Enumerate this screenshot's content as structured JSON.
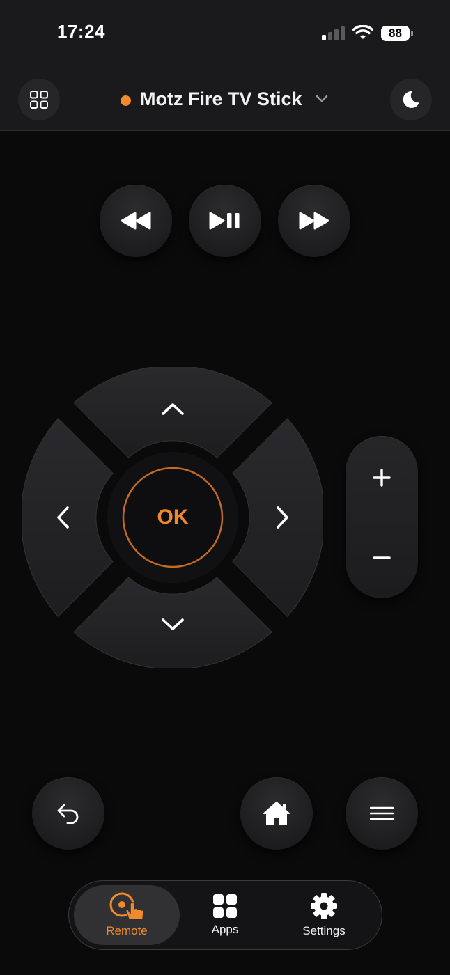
{
  "status_bar": {
    "time": "17:24",
    "battery": "88"
  },
  "header": {
    "device_name": "Motz Fire TV Stick",
    "status_color": "#f08a2c"
  },
  "icons": {
    "left": "grid-icon",
    "right": "moon-icon",
    "rewind": "rewind-icon",
    "play_pause": "play-pause-icon",
    "fast_forward": "fast-forward-icon",
    "back": "back-arrow-icon",
    "home": "home-icon",
    "menu": "menu-icon"
  },
  "dpad": {
    "ok_label": "OK"
  },
  "volume": {
    "up": "+",
    "down": "−"
  },
  "tabs": [
    {
      "label": "Remote",
      "icon": "remote-touch-icon",
      "active": true
    },
    {
      "label": "Apps",
      "icon": "apps-grid-icon",
      "active": false
    },
    {
      "label": "Settings",
      "icon": "gear-icon",
      "active": false
    }
  ],
  "colors": {
    "accent": "#f08a2c",
    "background": "#0a0a0b",
    "surface": "#1a1a1c"
  }
}
